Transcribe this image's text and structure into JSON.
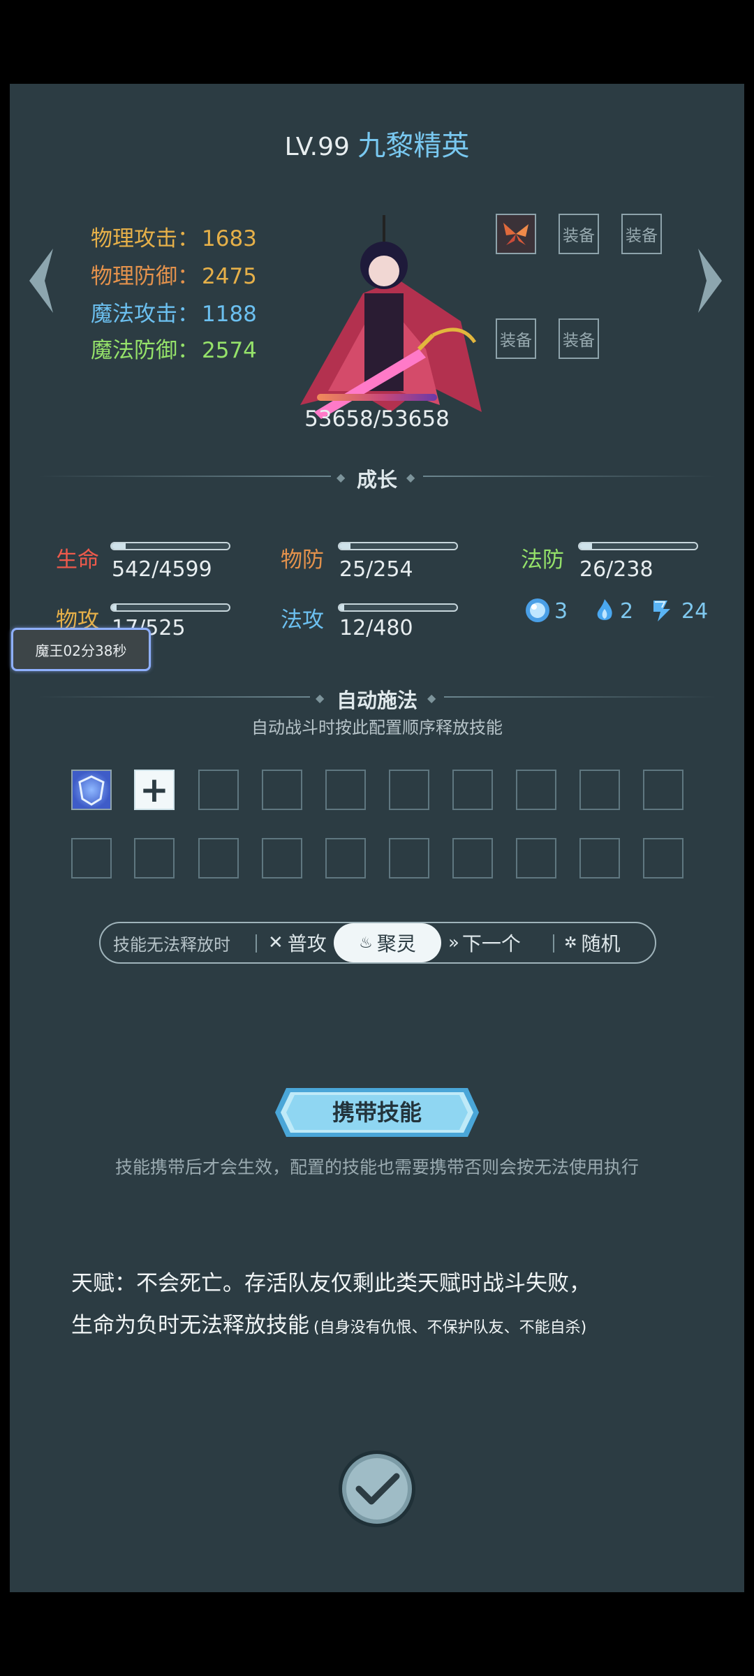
{
  "header": {
    "level": "LV.99",
    "name": "九黎精英"
  },
  "stats": {
    "phys_atk": {
      "label": "物理攻击：",
      "value": "1683",
      "color": "#e6b049"
    },
    "phys_def": {
      "label": "物理防御：",
      "value": "2475",
      "color": "#e4924c"
    },
    "mag_atk": {
      "label": "魔法攻击：",
      "value": "1188",
      "color": "#6cc0f0"
    },
    "mag_def": {
      "label": "魔法防御：",
      "value": "2574",
      "color": "#95e26a"
    }
  },
  "equipment": {
    "slot_label": "装备"
  },
  "hp": {
    "text": "53658/53658",
    "fraction": 1.0
  },
  "growth": {
    "title": "成长",
    "hp": {
      "label": "生命",
      "value": "542/4599",
      "fraction": 0.118,
      "color": "#ee5a4c"
    },
    "pdef": {
      "label": "物防",
      "value": "25/254",
      "fraction": 0.098,
      "color": "#e4924c"
    },
    "mdef": {
      "label": "法防",
      "value": "26/238",
      "fraction": 0.109,
      "color": "#95e26a"
    },
    "patk": {
      "label": "物攻",
      "value": "17/525",
      "fraction": 0.032,
      "color": "#e6b049"
    },
    "matk": {
      "label": "法攻",
      "value": "12/480",
      "fraction": 0.025,
      "color": "#6cc0f0"
    }
  },
  "resources": [
    {
      "icon": "blue-orb-icon",
      "value": "3"
    },
    {
      "icon": "blue-flame-icon",
      "value": "2"
    },
    {
      "icon": "lightning-boots-icon",
      "value": "24"
    }
  ],
  "demon_timer": "魔王02分38秒",
  "auto_cast": {
    "title": "自动施法",
    "description": "自动战斗时按此配置顺序释放技能"
  },
  "fallback": {
    "prompt": "技能无法释放时",
    "options": [
      "普攻",
      "聚灵",
      "下一个",
      "随机"
    ],
    "selected": "聚灵"
  },
  "carry": {
    "button": "携带技能",
    "note": "技能携带后才会生效，配置的技能也需要携带否则会按无法使用执行"
  },
  "talent": {
    "line1": "天赋：不会死亡。存活队友仅剩此类天赋时战斗失败，",
    "line2": "生命为负时无法释放技能",
    "line2_note": "(自身没有仇恨、不保护队友、不能自杀)"
  }
}
